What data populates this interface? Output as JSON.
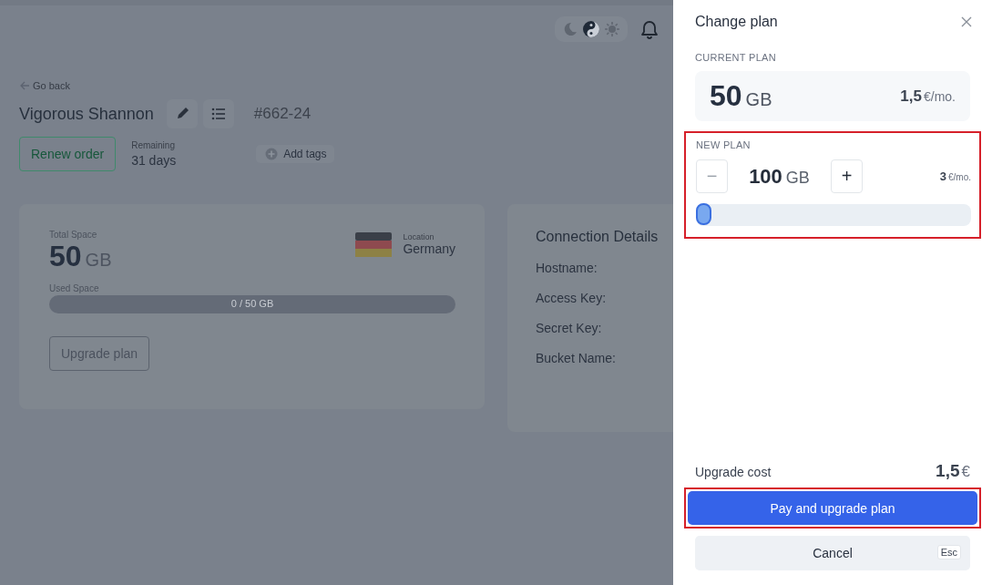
{
  "theme_switch": [
    {
      "kind": "dark",
      "selected": false
    },
    {
      "kind": "auto",
      "selected": true
    },
    {
      "kind": "light",
      "selected": false
    }
  ],
  "back_link": "Go back",
  "order": {
    "title": "Vigorous Shannon",
    "number_sign": "#",
    "number": "662-24",
    "renew_button": "Renew order",
    "remaining_label": "Remaining",
    "remaining_value": "31 days",
    "add_tags": "Add tags"
  },
  "storage_card": {
    "total_label": "Total Space",
    "total_value": "50",
    "total_unit": "GB",
    "location_label": "Location",
    "location": "Germany",
    "used_label": "Used Space",
    "usage": {
      "level": 0,
      "reading": "0 / 50 GB"
    },
    "upgrade_button": "Upgrade plan"
  },
  "connection_card": {
    "title": "Connection Details",
    "fields": [
      "Hostname:",
      "Access Key:",
      "Secret Key:",
      "Bucket Name:"
    ]
  },
  "drawer": {
    "title": "Change plan",
    "current_plan": {
      "label": "CURRENT PLAN",
      "size": "50",
      "unit": "GB",
      "price": "1,5",
      "price_unit": "€/mo."
    },
    "new_plan": {
      "label": "NEW PLAN",
      "highlighted": true,
      "minus": "−",
      "size": "100",
      "unit": "GB",
      "plus": "+",
      "price": "3",
      "price_unit": "€/mo.",
      "level": 0
    },
    "upgrade_cost": {
      "label": "Upgrade cost",
      "value": "1,5",
      "unit": "€"
    },
    "pay_button": {
      "label": "Pay and upgrade plan",
      "highlighted": true
    },
    "cancel_button": {
      "label": "Cancel",
      "shortcut": "Esc"
    }
  }
}
